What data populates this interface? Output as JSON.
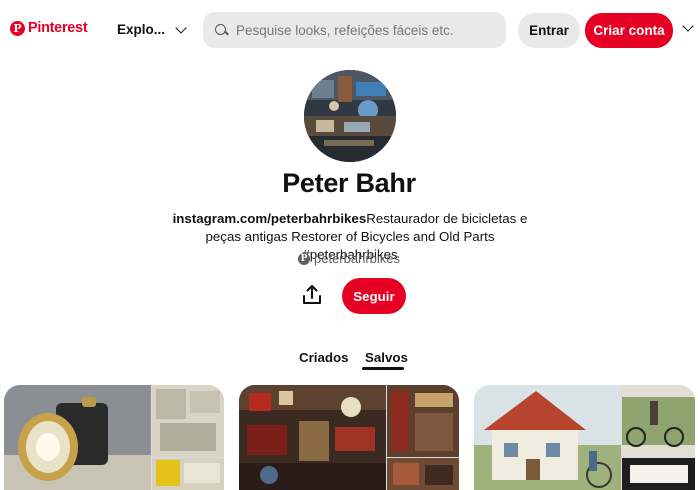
{
  "header": {
    "logo_mark": "P",
    "logo_text": "Pinterest",
    "explore_label": "Explo...",
    "search_placeholder": "Pesquise looks, refeições fáceis etc.",
    "login_label": "Entrar",
    "signup_label": "Criar conta"
  },
  "profile": {
    "name": "Peter Bahr",
    "bio_link": "instagram.com/peterbahrbikes",
    "bio_text": "Restaurador de bicicletas e peças antigas Restorer of Bicycles and Old Parts #peterbahrbikes",
    "handle": "peterbahrbikes",
    "handle_icon": "P",
    "follow_label": "Seguir"
  },
  "tabs": {
    "created": "Criados",
    "saved": "Salvos",
    "active": "saved"
  },
  "colors": {
    "brand": "#e60023",
    "button_gray": "#e9e9e9"
  },
  "icons": {
    "search": "search-icon",
    "chevron": "chevron-down-icon",
    "share": "share-icon"
  }
}
